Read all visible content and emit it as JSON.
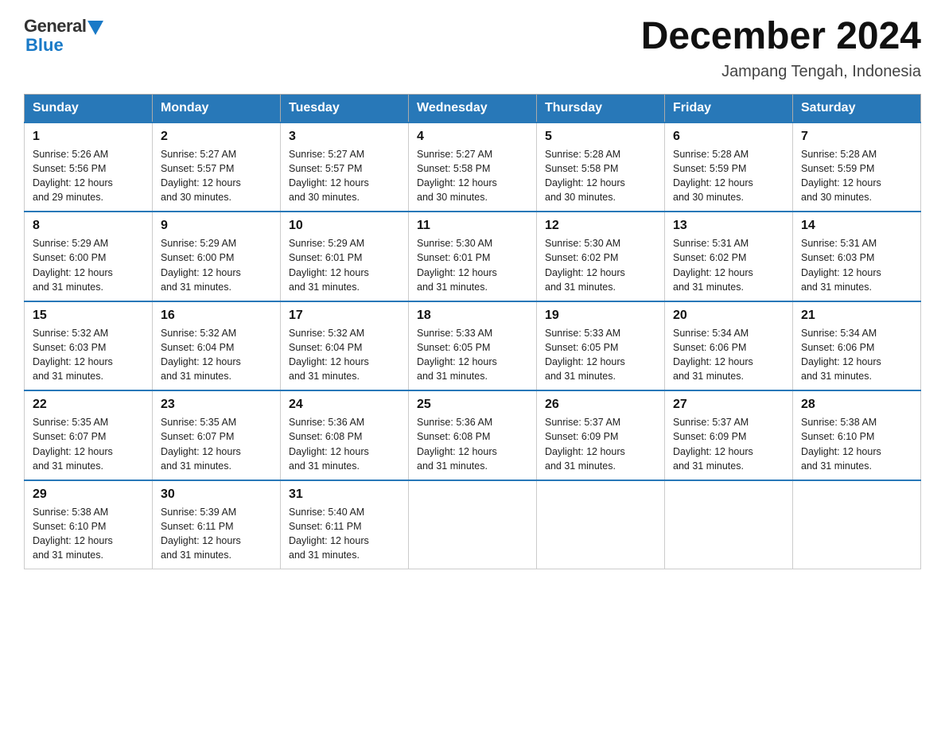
{
  "header": {
    "logo": {
      "general": "General",
      "blue": "Blue"
    },
    "title": "December 2024",
    "location": "Jampang Tengah, Indonesia"
  },
  "calendar": {
    "days_of_week": [
      "Sunday",
      "Monday",
      "Tuesday",
      "Wednesday",
      "Thursday",
      "Friday",
      "Saturday"
    ],
    "weeks": [
      [
        {
          "day": "1",
          "sunrise": "5:26 AM",
          "sunset": "5:56 PM",
          "daylight": "12 hours and 29 minutes."
        },
        {
          "day": "2",
          "sunrise": "5:27 AM",
          "sunset": "5:57 PM",
          "daylight": "12 hours and 30 minutes."
        },
        {
          "day": "3",
          "sunrise": "5:27 AM",
          "sunset": "5:57 PM",
          "daylight": "12 hours and 30 minutes."
        },
        {
          "day": "4",
          "sunrise": "5:27 AM",
          "sunset": "5:58 PM",
          "daylight": "12 hours and 30 minutes."
        },
        {
          "day": "5",
          "sunrise": "5:28 AM",
          "sunset": "5:58 PM",
          "daylight": "12 hours and 30 minutes."
        },
        {
          "day": "6",
          "sunrise": "5:28 AM",
          "sunset": "5:59 PM",
          "daylight": "12 hours and 30 minutes."
        },
        {
          "day": "7",
          "sunrise": "5:28 AM",
          "sunset": "5:59 PM",
          "daylight": "12 hours and 30 minutes."
        }
      ],
      [
        {
          "day": "8",
          "sunrise": "5:29 AM",
          "sunset": "6:00 PM",
          "daylight": "12 hours and 31 minutes."
        },
        {
          "day": "9",
          "sunrise": "5:29 AM",
          "sunset": "6:00 PM",
          "daylight": "12 hours and 31 minutes."
        },
        {
          "day": "10",
          "sunrise": "5:29 AM",
          "sunset": "6:01 PM",
          "daylight": "12 hours and 31 minutes."
        },
        {
          "day": "11",
          "sunrise": "5:30 AM",
          "sunset": "6:01 PM",
          "daylight": "12 hours and 31 minutes."
        },
        {
          "day": "12",
          "sunrise": "5:30 AM",
          "sunset": "6:02 PM",
          "daylight": "12 hours and 31 minutes."
        },
        {
          "day": "13",
          "sunrise": "5:31 AM",
          "sunset": "6:02 PM",
          "daylight": "12 hours and 31 minutes."
        },
        {
          "day": "14",
          "sunrise": "5:31 AM",
          "sunset": "6:03 PM",
          "daylight": "12 hours and 31 minutes."
        }
      ],
      [
        {
          "day": "15",
          "sunrise": "5:32 AM",
          "sunset": "6:03 PM",
          "daylight": "12 hours and 31 minutes."
        },
        {
          "day": "16",
          "sunrise": "5:32 AM",
          "sunset": "6:04 PM",
          "daylight": "12 hours and 31 minutes."
        },
        {
          "day": "17",
          "sunrise": "5:32 AM",
          "sunset": "6:04 PM",
          "daylight": "12 hours and 31 minutes."
        },
        {
          "day": "18",
          "sunrise": "5:33 AM",
          "sunset": "6:05 PM",
          "daylight": "12 hours and 31 minutes."
        },
        {
          "day": "19",
          "sunrise": "5:33 AM",
          "sunset": "6:05 PM",
          "daylight": "12 hours and 31 minutes."
        },
        {
          "day": "20",
          "sunrise": "5:34 AM",
          "sunset": "6:06 PM",
          "daylight": "12 hours and 31 minutes."
        },
        {
          "day": "21",
          "sunrise": "5:34 AM",
          "sunset": "6:06 PM",
          "daylight": "12 hours and 31 minutes."
        }
      ],
      [
        {
          "day": "22",
          "sunrise": "5:35 AM",
          "sunset": "6:07 PM",
          "daylight": "12 hours and 31 minutes."
        },
        {
          "day": "23",
          "sunrise": "5:35 AM",
          "sunset": "6:07 PM",
          "daylight": "12 hours and 31 minutes."
        },
        {
          "day": "24",
          "sunrise": "5:36 AM",
          "sunset": "6:08 PM",
          "daylight": "12 hours and 31 minutes."
        },
        {
          "day": "25",
          "sunrise": "5:36 AM",
          "sunset": "6:08 PM",
          "daylight": "12 hours and 31 minutes."
        },
        {
          "day": "26",
          "sunrise": "5:37 AM",
          "sunset": "6:09 PM",
          "daylight": "12 hours and 31 minutes."
        },
        {
          "day": "27",
          "sunrise": "5:37 AM",
          "sunset": "6:09 PM",
          "daylight": "12 hours and 31 minutes."
        },
        {
          "day": "28",
          "sunrise": "5:38 AM",
          "sunset": "6:10 PM",
          "daylight": "12 hours and 31 minutes."
        }
      ],
      [
        {
          "day": "29",
          "sunrise": "5:38 AM",
          "sunset": "6:10 PM",
          "daylight": "12 hours and 31 minutes."
        },
        {
          "day": "30",
          "sunrise": "5:39 AM",
          "sunset": "6:11 PM",
          "daylight": "12 hours and 31 minutes."
        },
        {
          "day": "31",
          "sunrise": "5:40 AM",
          "sunset": "6:11 PM",
          "daylight": "12 hours and 31 minutes."
        },
        null,
        null,
        null,
        null
      ]
    ]
  }
}
